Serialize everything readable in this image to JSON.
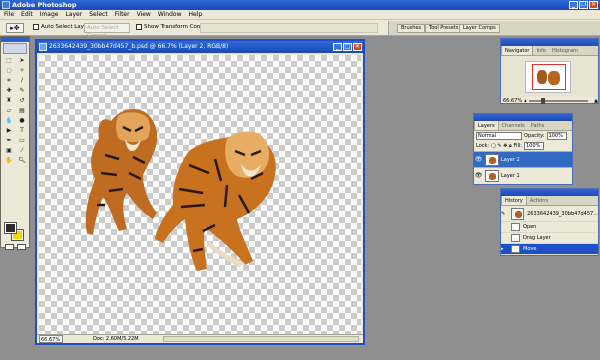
{
  "app": {
    "title": "Adobe Photoshop"
  },
  "menu": [
    "File",
    "Edit",
    "Image",
    "Layer",
    "Select",
    "Filter",
    "View",
    "Window",
    "Help"
  ],
  "options": {
    "auto_select_layer": "Auto Select Layer",
    "auto_select_groups": "Auto Select Groups",
    "show_transform_controls": "Show Transform Controls"
  },
  "palette_well": [
    "Brushes",
    "Tool Presets",
    "Layer Comps"
  ],
  "document": {
    "title": "2633642439_30bb47d457_b.psd @ 66.7% (Layer 2, RGB/8)",
    "zoom": "66.67%",
    "doc_size": "Doc: 2.60M/5.22M"
  },
  "navigator": {
    "tabs": [
      "Navigator",
      "Info",
      "Histogram"
    ],
    "zoom": "66.67%"
  },
  "layers": {
    "tabs": [
      "Layers",
      "Channels",
      "Paths"
    ],
    "blend_mode": "Normal",
    "opacity_label": "Opacity:",
    "opacity_value": "100%",
    "lock_label": "Lock:",
    "fill_label": "Fill:",
    "fill_value": "100%",
    "items": [
      {
        "name": "Layer 2",
        "selected": true
      },
      {
        "name": "Layer 1",
        "selected": false
      }
    ]
  },
  "history": {
    "tabs": [
      "History",
      "Actions"
    ],
    "snapshot": "2633642439_30bb47d457...",
    "items": [
      "Open",
      "Drag Layer",
      "Move"
    ]
  },
  "colors": {
    "foreground": "#2c2c2c",
    "background": "#f0d800",
    "title_bar": "#1d4fc5"
  }
}
